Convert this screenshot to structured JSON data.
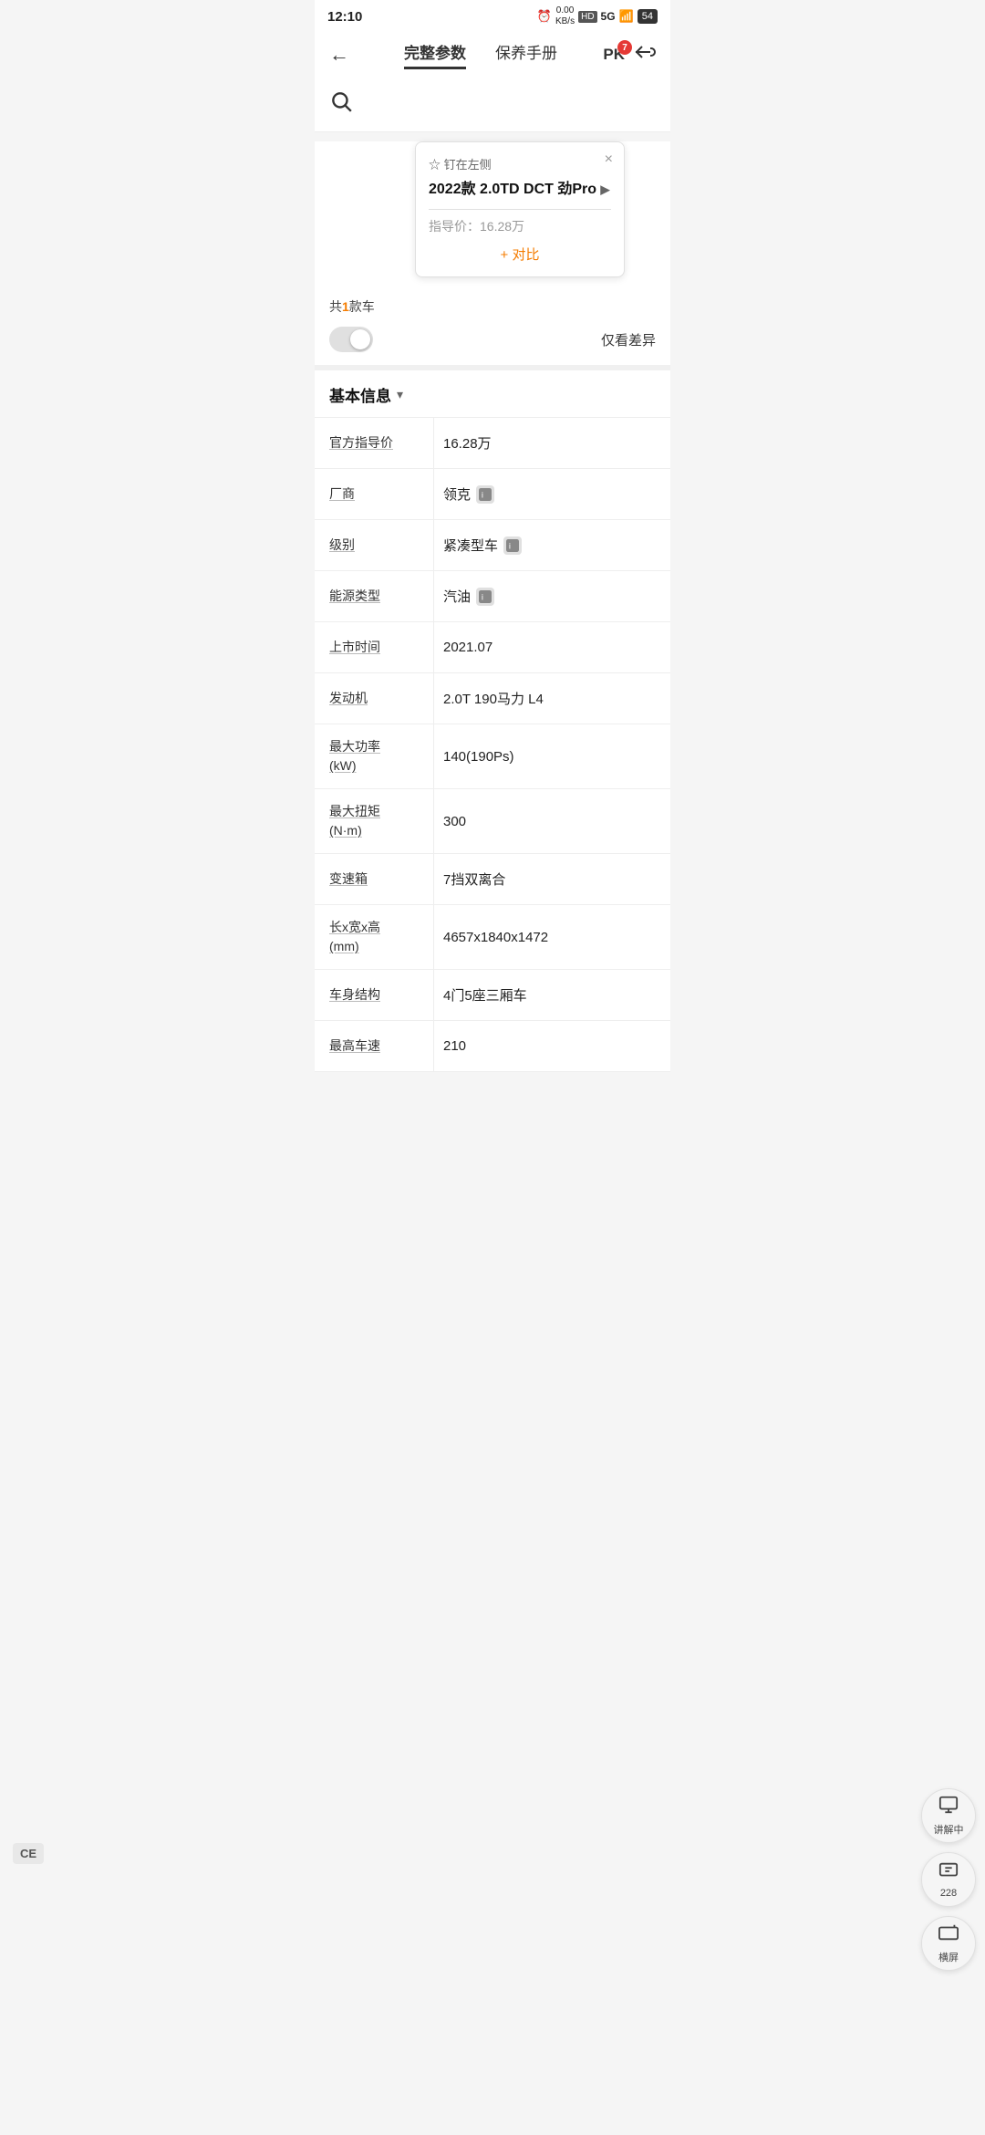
{
  "statusBar": {
    "time": "12:10",
    "netSpeed": "0.00\nKB/s",
    "networkType": "5G",
    "batteryLevel": "54"
  },
  "nav": {
    "backLabel": "←",
    "tab1Label": "完整参数",
    "tab2Label": "保养手册",
    "pkLabel": "PK",
    "pkBadge": "7",
    "shareLabel": "⬜"
  },
  "search": {
    "iconLabel": "🔍"
  },
  "popup": {
    "pinLabel": "☆ 钉在左侧",
    "closeLabel": "×",
    "carName": "2022款 2.0TD DCT 劲Pro",
    "arrowLabel": "▶",
    "priceLabel": "指导价：16.28万",
    "addCompareLabel": "+ 对比"
  },
  "filterRow": {
    "countText": "共",
    "countNum": "1",
    "countSuffix": "款车",
    "diffLabel": "仅看差异"
  },
  "section": {
    "title": "基本信息",
    "arrow": "▾"
  },
  "params": [
    {
      "label": "官方指导价",
      "value": "16.28万",
      "hasIcon": false
    },
    {
      "label": "厂商",
      "value": "领克",
      "hasIcon": true
    },
    {
      "label": "级别",
      "value": "紧凑型车",
      "hasIcon": true
    },
    {
      "label": "能源类型",
      "value": "汽油",
      "hasIcon": true
    },
    {
      "label": "上市时间",
      "value": "2021.07",
      "hasIcon": false
    },
    {
      "label": "发动机",
      "value": "2.0T 190马力 L4",
      "hasIcon": false
    },
    {
      "label": "最大功率\n(kW)",
      "value": "140(190Ps)",
      "hasIcon": false
    },
    {
      "label": "最大扭矩\n(N·m)",
      "value": "300",
      "hasIcon": false
    },
    {
      "label": "变速箱",
      "value": "7挡双离合",
      "hasIcon": false
    },
    {
      "label": "长x宽x高\n(mm)",
      "value": "4657x1840x1472",
      "hasIcon": false
    },
    {
      "label": "车身结构",
      "value": "4门5座三厢车",
      "hasIcon": false
    },
    {
      "label": "最高车速",
      "value": "210",
      "hasIcon": false
    }
  ],
  "floatButtons": [
    {
      "icon": "⊞",
      "label": "讲解中"
    },
    {
      "icon": "💬",
      "label": "228"
    },
    {
      "icon": "⊡",
      "label": "横屏"
    }
  ],
  "ceBadge": "CE"
}
